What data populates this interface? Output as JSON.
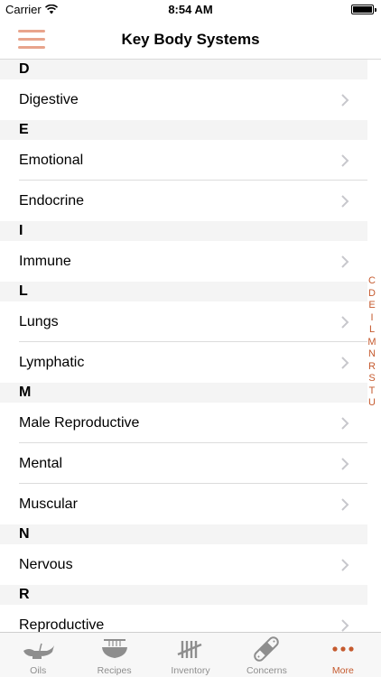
{
  "status_bar": {
    "carrier": "Carrier",
    "time": "8:54 AM"
  },
  "nav": {
    "title": "Key Body Systems"
  },
  "sections": [
    {
      "letter": "D",
      "items": [
        "Digestive"
      ]
    },
    {
      "letter": "E",
      "items": [
        "Emotional",
        "Endocrine"
      ]
    },
    {
      "letter": "I",
      "items": [
        "Immune"
      ]
    },
    {
      "letter": "L",
      "items": [
        "Lungs",
        "Lymphatic"
      ]
    },
    {
      "letter": "M",
      "items": [
        "Male Reproductive",
        "Mental",
        "Muscular"
      ]
    },
    {
      "letter": "N",
      "items": [
        "Nervous"
      ]
    },
    {
      "letter": "R",
      "items": [
        "Reproductive"
      ]
    }
  ],
  "index_letters": [
    "C",
    "D",
    "E",
    "I",
    "L",
    "M",
    "N",
    "R",
    "S",
    "T",
    "U"
  ],
  "tabs": [
    {
      "label": "Oils",
      "icon": "oil-lamp-icon"
    },
    {
      "label": "Recipes",
      "icon": "bowl-icon"
    },
    {
      "label": "Inventory",
      "icon": "tally-icon"
    },
    {
      "label": "Concerns",
      "icon": "bandage-icon"
    },
    {
      "label": "More",
      "icon": "more-dots-icon"
    }
  ],
  "active_tab": "More",
  "colors": {
    "accent": "#c55a2e",
    "menu_icon": "#e8a48c",
    "section_bg": "#f4f4f4",
    "tab_inactive": "#8e8e8e"
  }
}
